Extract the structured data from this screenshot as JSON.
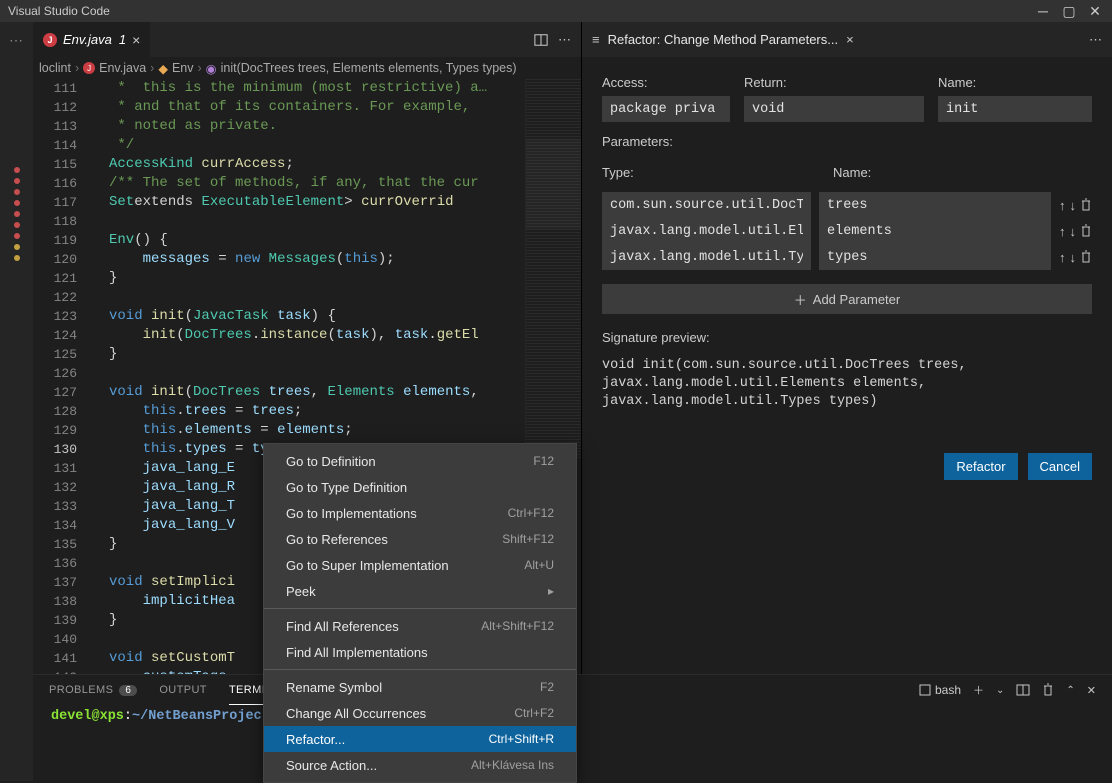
{
  "title": "Visual Studio Code",
  "tab": {
    "file": "Env.java",
    "mod": "1"
  },
  "breadcrumbs": {
    "pkg": "loclint",
    "file": "Env.java",
    "class": "Env",
    "method": "init(DocTrees trees, Elements elements, Types types)"
  },
  "lines": {
    "start": 111,
    "active": 130,
    "text": [
      " *  this is the minimum (most restrictive) a…",
      " * and that of its containers. For example,",
      " * noted as private.",
      " */",
      "AccessKind currAccess;",
      "/** The set of methods, if any, that the cur",
      "Set<? extends ExecutableElement> currOverrid",
      "",
      "Env() {",
      "    messages = new Messages(this);",
      "}",
      "",
      "void init(JavacTask task) {",
      "    init(DocTrees.instance(task), task.getEl",
      "}",
      "",
      "void init(DocTrees trees, Elements elements,",
      "    this.trees = trees;",
      "    this.elements = elements;",
      "    this.types = types;",
      "    java_lang_E",
      "    java_lang_R",
      "    java_lang_T",
      "    java_lang_V",
      "}",
      "",
      "void setImplici",
      "    implicitHea",
      "}",
      "",
      "void setCustomT",
      "    customTags"
    ]
  },
  "ctx": [
    {
      "label": "Go to Definition",
      "kbd": "F12"
    },
    {
      "label": "Go to Type Definition",
      "kbd": ""
    },
    {
      "label": "Go to Implementations",
      "kbd": "Ctrl+F12"
    },
    {
      "label": "Go to References",
      "kbd": "Shift+F12"
    },
    {
      "label": "Go to Super Implementation",
      "kbd": "Alt+U"
    },
    {
      "label": "Peek",
      "kbd": "",
      "sub": true
    },
    {
      "sep": true
    },
    {
      "label": "Find All References",
      "kbd": "Alt+Shift+F12"
    },
    {
      "label": "Find All Implementations",
      "kbd": ""
    },
    {
      "sep": true
    },
    {
      "label": "Rename Symbol",
      "kbd": "F2"
    },
    {
      "label": "Change All Occurrences",
      "kbd": "Ctrl+F2"
    },
    {
      "label": "Refactor...",
      "kbd": "Ctrl+Shift+R",
      "hl": true
    },
    {
      "label": "Source Action...",
      "kbd": "Alt+Klávesa Ins"
    }
  ],
  "panel_tabs": {
    "problems": "PROBLEMS",
    "badge": "6",
    "output": "OUTPUT",
    "terminal": "TERMI"
  },
  "panel_actions": {
    "shell": "bash"
  },
  "terminal": {
    "user": "devel@xps",
    "sep": ":",
    "path": "~/NetBeansProjec"
  },
  "refactor": {
    "title": "Refactor: Change Method Parameters...",
    "labels": {
      "access": "Access:",
      "return": "Return:",
      "name": "Name:",
      "params": "Parameters:",
      "type": "Type:",
      "pname": "Name:",
      "add": "Add Parameter",
      "sig": "Signature preview:"
    },
    "access": "package priva",
    "return": "void",
    "name": "init",
    "params": [
      {
        "type": "com.sun.source.util.DocTre",
        "name": "trees"
      },
      {
        "type": "javax.lang.model.util.Elem",
        "name": "elements"
      },
      {
        "type": "javax.lang.model.util.Type",
        "name": "types"
      }
    ],
    "sig_lines": [
      "void init(com.sun.source.util.DocTrees trees,",
      "javax.lang.model.util.Elements elements,",
      "javax.lang.model.util.Types types)"
    ],
    "buttons": {
      "ok": "Refactor",
      "cancel": "Cancel"
    }
  }
}
